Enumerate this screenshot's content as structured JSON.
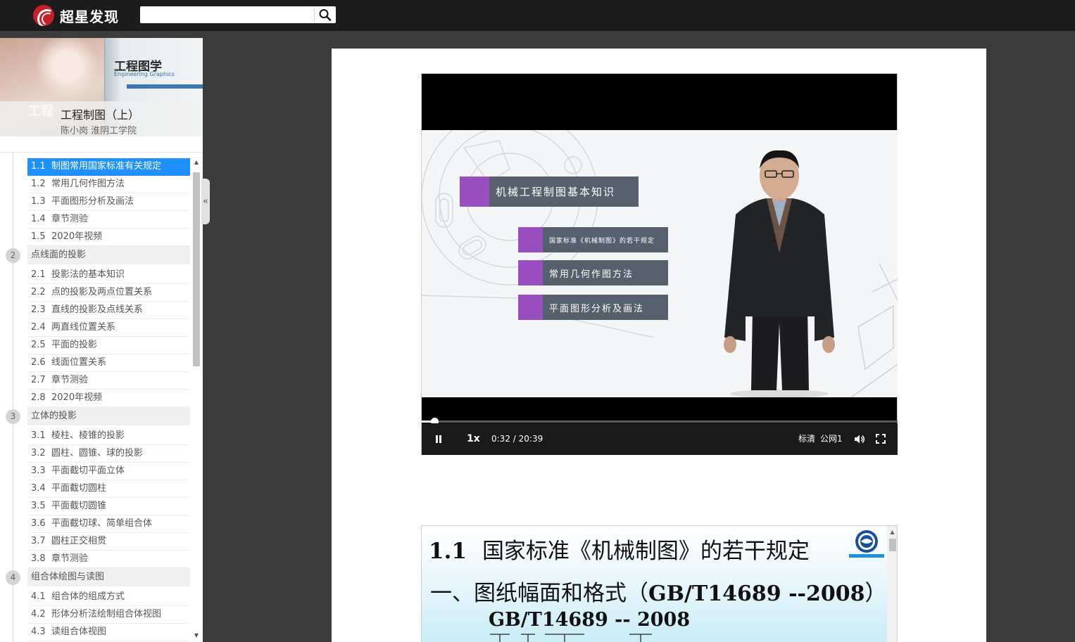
{
  "app": {
    "brand": "超星发现"
  },
  "search": {
    "value": "",
    "placeholder": ""
  },
  "book": {
    "cover_title_cn": "工程图学",
    "cover_title_en": "Engineering Graphics",
    "cover_watermark": "工程",
    "title": "工程制图（上）",
    "author": "陈小岗 淮阴工学院"
  },
  "toc": {
    "collapse_glyph": "«",
    "entries": [
      {
        "type": "item",
        "num": "1.1",
        "label": "制图常用国家标准有关规定",
        "active": true
      },
      {
        "type": "item",
        "num": "1.2",
        "label": "常用几何作图方法"
      },
      {
        "type": "item",
        "num": "1.3",
        "label": "平面图形分析及画法"
      },
      {
        "type": "item",
        "num": "1.4",
        "label": "章节测验"
      },
      {
        "type": "item",
        "num": "1.5",
        "label": "2020年视频"
      },
      {
        "type": "chapter",
        "num": "2",
        "label": "点线面的投影"
      },
      {
        "type": "item",
        "num": "2.1",
        "label": "投影法的基本知识"
      },
      {
        "type": "item",
        "num": "2.2",
        "label": "点的投影及两点位置关系"
      },
      {
        "type": "item",
        "num": "2.3",
        "label": "直线的投影及点线关系"
      },
      {
        "type": "item",
        "num": "2.4",
        "label": "两直线位置关系"
      },
      {
        "type": "item",
        "num": "2.5",
        "label": "平面的投影"
      },
      {
        "type": "item",
        "num": "2.6",
        "label": "线面位置关系"
      },
      {
        "type": "item",
        "num": "2.7",
        "label": "章节测验"
      },
      {
        "type": "item",
        "num": "2.8",
        "label": "2020年视频"
      },
      {
        "type": "chapter",
        "num": "3",
        "label": "立体的投影"
      },
      {
        "type": "item",
        "num": "3.1",
        "label": "棱柱、棱锥的投影"
      },
      {
        "type": "item",
        "num": "3.2",
        "label": "圆柱、圆锥、球的投影"
      },
      {
        "type": "item",
        "num": "3.3",
        "label": "平面截切平面立体"
      },
      {
        "type": "item",
        "num": "3.4",
        "label": "平面截切圆柱"
      },
      {
        "type": "item",
        "num": "3.5",
        "label": "平面截切圆锥"
      },
      {
        "type": "item",
        "num": "3.6",
        "label": "平面截切球、简单组合体"
      },
      {
        "type": "item",
        "num": "3.7",
        "label": "圆柱正交相贯"
      },
      {
        "type": "item",
        "num": "3.8",
        "label": "章节测验"
      },
      {
        "type": "chapter",
        "num": "4",
        "label": "组合体绘图与读图"
      },
      {
        "type": "item",
        "num": "4.1",
        "label": "组合体的组成方式"
      },
      {
        "type": "item",
        "num": "4.2",
        "label": "形体分析法绘制组合体视图"
      },
      {
        "type": "item",
        "num": "4.3",
        "label": "读组合体视图"
      }
    ]
  },
  "video": {
    "frame_title": "机械工程制图基本知识",
    "frame_items": [
      "国家标准《机械制图》的若干规定",
      "常用几何作图方法",
      "平面图形分析及画法"
    ],
    "speed": "1x",
    "time_current": "0:32",
    "time_sep": "/",
    "time_total": "20:39",
    "progress_fraction": 0.026,
    "quality": "标清",
    "line": "公网1"
  },
  "slide": {
    "section": "1.1",
    "title": "国家标准《机械制图》的若干规定",
    "subtitle_prefix": "一、图纸幅面和格式（",
    "subtitle_std": "GB/T14689 --2008",
    "subtitle_suffix": "）",
    "standard": "GB/T14689 -- 2008"
  },
  "colors": {
    "active_toc": "#1e90ff",
    "accent_purple": "#9a4fc0",
    "menu_gray": "#56606c",
    "topbar": "#1c1c1c"
  }
}
